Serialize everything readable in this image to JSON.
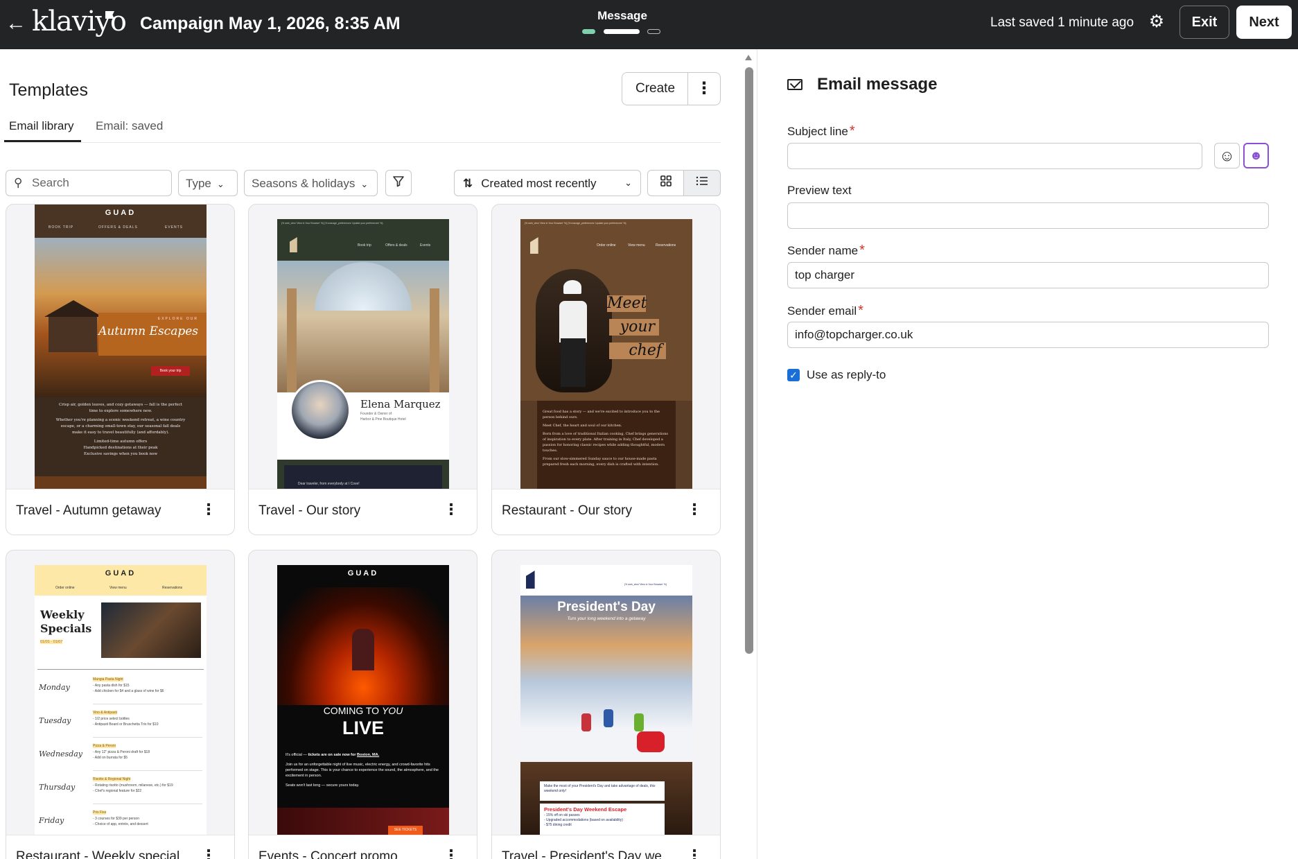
{
  "topbar": {
    "back_icon": "arrow-left-icon",
    "logo": "klaviyo",
    "campaign_title": "Campaign May 1, 2026, 8:35 AM",
    "step_label": "Message",
    "last_saved": "Last saved 1 minute ago",
    "settings_icon": "gear-icon",
    "exit_label": "Exit",
    "next_label": "Next"
  },
  "templates": {
    "title": "Templates",
    "create_label": "Create",
    "tabs": [
      "Email library",
      "Email: saved"
    ],
    "active_tab": "Email library",
    "search_placeholder": "Search",
    "filters": {
      "type": "Type",
      "seasons": "Seasons & holidays"
    },
    "sort_label": "Created most recently",
    "view_mode": "grid",
    "cards": [
      {
        "name": "Travel - Autumn getaway"
      },
      {
        "name": "Travel - Our story"
      },
      {
        "name": "Restaurant - Our story"
      },
      {
        "name": "Restaurant - Weekly special"
      },
      {
        "name": "Events - Concert promo"
      },
      {
        "name": "Travel - President's Day we"
      }
    ],
    "thumbs": {
      "autumn": {
        "logo": "GUAD",
        "nav": [
          "BOOK TRIP",
          "OFFERS & DEALS",
          "EVENTS"
        ],
        "kicker": "EXPLORE OUR",
        "headline": "Autumn Escapes",
        "cta": "Book your trip",
        "body": "Crisp air, golden leaves, and cozy getaways — fall is the perfect time to explore somewhere new.",
        "body2": "Whether you're planning a scenic weekend retreat, a wine country escape, or a charming small-town stay, our seasonal fall deals make it easy to travel beautifully (and affordably).",
        "bullets": [
          "Limited-time autumn offers",
          "Handpicked destinations at their peak",
          "Exclusive savings when you book now"
        ]
      },
      "story": {
        "top": "{% web_view 'View in Your Browser' %} {% manage_preferences 'Update your preferences' %}",
        "nav": [
          "Book trip",
          "Offers & deals",
          "Events"
        ],
        "person": "Elena Marquez",
        "role": "Founder & Owner of",
        "hotel": "Harbor & Pine Boutique Hotel",
        "bottom": "Dear traveler, from everybody at I Cove!"
      },
      "restaurant": {
        "top": "{% web_view 'View in Your Browser' %} {% manage_preferences 'Update your preferences' %}",
        "nav": [
          "Order online",
          "View menu",
          "Reservations"
        ],
        "words": [
          "Meet",
          "your",
          "chef"
        ],
        "body": "Great food has a story — and we're excited to introduce you to the person behind ours.",
        "body2": "Meet Chef, the heart and soul of our kitchen.",
        "body3": "Born from a love of traditional Italian cooking, Chef brings generations of inspiration to every plate. After training in Italy, Chef developed a passion for honoring classic recipes while adding thoughtful, modern touches.",
        "body4": "From our slow-simmered Sunday sauce to our house-made pasta prepared fresh each morning, every dish is crafted with intention."
      },
      "weekly": {
        "logo": "GUAD",
        "nav": [
          "Order online",
          "View menu",
          "Reservations"
        ],
        "title": "Weekly Specials",
        "dates": "01/01 - 01/07",
        "days": [
          {
            "day": "Monday",
            "tag": "Mangia Pasta Night",
            "l1": "- Any pasta dish for $15",
            "l2": "- Add chicken for $4 and a glass of wine for $6"
          },
          {
            "day": "Tuesday",
            "tag": "Vino & Antipasti",
            "l1": "- 1/2 price select bottles",
            "l2": "- Antipasti Board or Bruschetta Trio for $10"
          },
          {
            "day": "Wednesday",
            "tag": "Pizza & Peroni",
            "l1": "- Any 12\" pizza & Peroni draft for $18",
            "l2": "- Add on burrata for $5"
          },
          {
            "day": "Thursday",
            "tag": "Risotto & Regional Night",
            "l1": "- Rotating risotto (mushroom, milanese, etc.) for $19",
            "l2": "- Chef's regional feature for $22"
          },
          {
            "day": "Friday",
            "tag": "Prix Fixe",
            "l1": "- 3 courses for $39 per person",
            "l2": "- Choice of app, entrée, and dessert"
          }
        ]
      },
      "concert": {
        "logo": "GUAD",
        "coming": "COMING TO",
        "you": "YOU",
        "live": "LIVE",
        "p1_a": "It's official — ",
        "p1_b": "tickets are on sale now for ",
        "p1_c": "Boston, MA.",
        "p2": "Join us for an unforgettable night of live music, electric energy, and crowd-favorite hits performed on stage. This is your chance to experience the sound, the atmosphere, and the excitement in person.",
        "p3": "Seats won't last long — secure yours today.",
        "cta": "SEE TICKETS"
      },
      "presidents": {
        "top": "{% web_view 'View in Your Browser' %}",
        "title": "President's Day",
        "sub": "Turn your long weekend into a getaway",
        "box_a": "Make the most of your President's Day and take advantage of deals, ",
        "box_b": "this weekend only!",
        "offer": "President's Day Weekend Escape",
        "o1": "- 15% off on ski passes",
        "o2": "- Upgraded accommodations (based on availability)",
        "o3": "- $75 dining credit"
      }
    }
  },
  "email_message": {
    "title": "Email message",
    "subject_label": "Subject line",
    "subject_value": "",
    "preview_label": "Preview text",
    "preview_value": "",
    "sender_name_label": "Sender name",
    "sender_name_value": "top charger",
    "sender_email_label": "Sender email",
    "sender_email_value": "info@topcharger.co.uk",
    "reply_to_label": "Use as reply-to",
    "reply_to_checked": true,
    "colors": {
      "required": "#d0342c",
      "checkbox": "#1a6fd6",
      "accent": "#8a4fd4"
    }
  }
}
